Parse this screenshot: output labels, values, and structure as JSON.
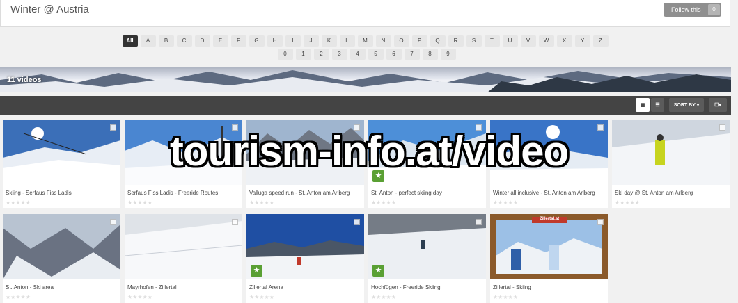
{
  "header": {
    "title": "Winter @ Austria",
    "follow_label": "Follow this",
    "follow_count": "0"
  },
  "alphabet": {
    "all_label": "All",
    "letters": [
      "A",
      "B",
      "C",
      "D",
      "E",
      "F",
      "G",
      "H",
      "I",
      "J",
      "K",
      "L",
      "M",
      "N",
      "O",
      "P",
      "Q",
      "R",
      "S",
      "T",
      "U",
      "V",
      "W",
      "X",
      "Y",
      "Z"
    ],
    "digits": [
      "0",
      "1",
      "2",
      "3",
      "4",
      "5",
      "6",
      "7",
      "8",
      "9"
    ]
  },
  "banner": {
    "count_label": "11 videos"
  },
  "toolbar": {
    "sort_label": "SORT BY ▾",
    "grid_icon": "grid-icon",
    "list_icon": "list-icon",
    "select_label": "☐▾"
  },
  "videos": [
    {
      "title": "Skiing - Serfaus Fiss Ladis",
      "featured": false
    },
    {
      "title": "Serfaus Fiss Ladis - Freeride Routes",
      "featured": false
    },
    {
      "title": "Valluga speed run - St. Anton am Arlberg",
      "featured": false
    },
    {
      "title": "St. Anton - perfect skiing day",
      "featured": true
    },
    {
      "title": "Winter all inclusive - St. Anton am Arlberg",
      "featured": false
    },
    {
      "title": "Ski day @ St. Anton am Arlberg",
      "featured": false
    },
    {
      "title": "St. Anton - Ski area",
      "featured": false
    },
    {
      "title": "Mayrhofen - Zillertal",
      "featured": false
    },
    {
      "title": "Zillertal Arena",
      "featured": true
    },
    {
      "title": "Hochfügen - Freeride Skiing",
      "featured": true
    },
    {
      "title": "Zillertal - Skiing",
      "featured": false
    }
  ],
  "stars": "★★★★★",
  "watermark": "tourism-info.at/video",
  "frame_logo": "Zillertal.at"
}
